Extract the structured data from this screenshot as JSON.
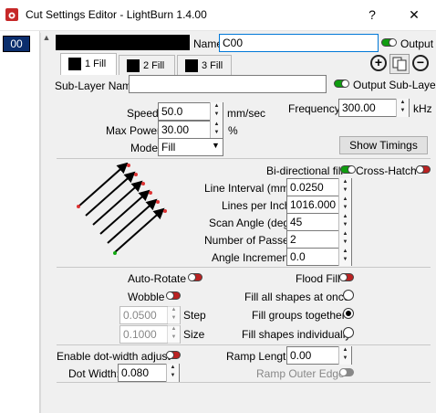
{
  "window": {
    "title": "Cut Settings Editor - LightBurn 1.4.00",
    "help_btn": "?",
    "close_btn": "✕"
  },
  "layer_badge": "00",
  "name_label": "Name",
  "name_value": "C00",
  "output_label": "Output",
  "tabs": [
    {
      "label": "1 Fill"
    },
    {
      "label": "2 Fill"
    },
    {
      "label": "3 Fill"
    }
  ],
  "sublayer_name_label": "Sub-Layer Name",
  "sublayer_name_value": "",
  "output_sublayer_label": "Output Sub-Layer",
  "speed": {
    "label": "Speed",
    "value": "50.0",
    "unit": "mm/sec"
  },
  "max_power": {
    "label": "Max Power",
    "value": "30.00",
    "unit": "%"
  },
  "mode": {
    "label": "Mode",
    "value": "Fill"
  },
  "frequency": {
    "label": "Frequency",
    "value": "300.00",
    "unit": "kHz"
  },
  "show_timings": "Show Timings",
  "bidirectional_label": "Bi-directional fill",
  "crosshatch_label": "Cross-Hatch",
  "line_interval": {
    "label": "Line Interval (mm)",
    "value": "0.0250"
  },
  "lines_per_inch": {
    "label": "Lines per Inch",
    "value": "1016.000"
  },
  "scan_angle": {
    "label": "Scan Angle (deg)",
    "value": "45"
  },
  "num_passes": {
    "label": "Number of Passes",
    "value": "2"
  },
  "angle_increment": {
    "label": "Angle Increment",
    "value": "0.0"
  },
  "auto_rotate_label": "Auto-Rotate",
  "flood_fill_label": "Flood Fill",
  "wobble_label": "Wobble",
  "step": {
    "label": "Step",
    "value": "0.0500"
  },
  "size": {
    "label": "Size",
    "value": "0.1000"
  },
  "fill_options": [
    {
      "label": "Fill all shapes at once",
      "selected": false
    },
    {
      "label": "Fill groups together",
      "selected": true
    },
    {
      "label": "Fill shapes individually",
      "selected": false
    }
  ],
  "dot_width_adjust_label": "Enable dot-width adjust",
  "dot_width": {
    "label": "Dot Width:",
    "value": "0.080"
  },
  "ramp_length": {
    "label": "Ramp Length",
    "value": "0.00"
  },
  "ramp_outer_edge_label": "Ramp Outer Edge",
  "colors": {
    "layer_badge_bg": "#0b2e6d",
    "toggle_on": "#0f9d0f",
    "toggle_off": "#b22222",
    "focus": "#0078d7"
  }
}
